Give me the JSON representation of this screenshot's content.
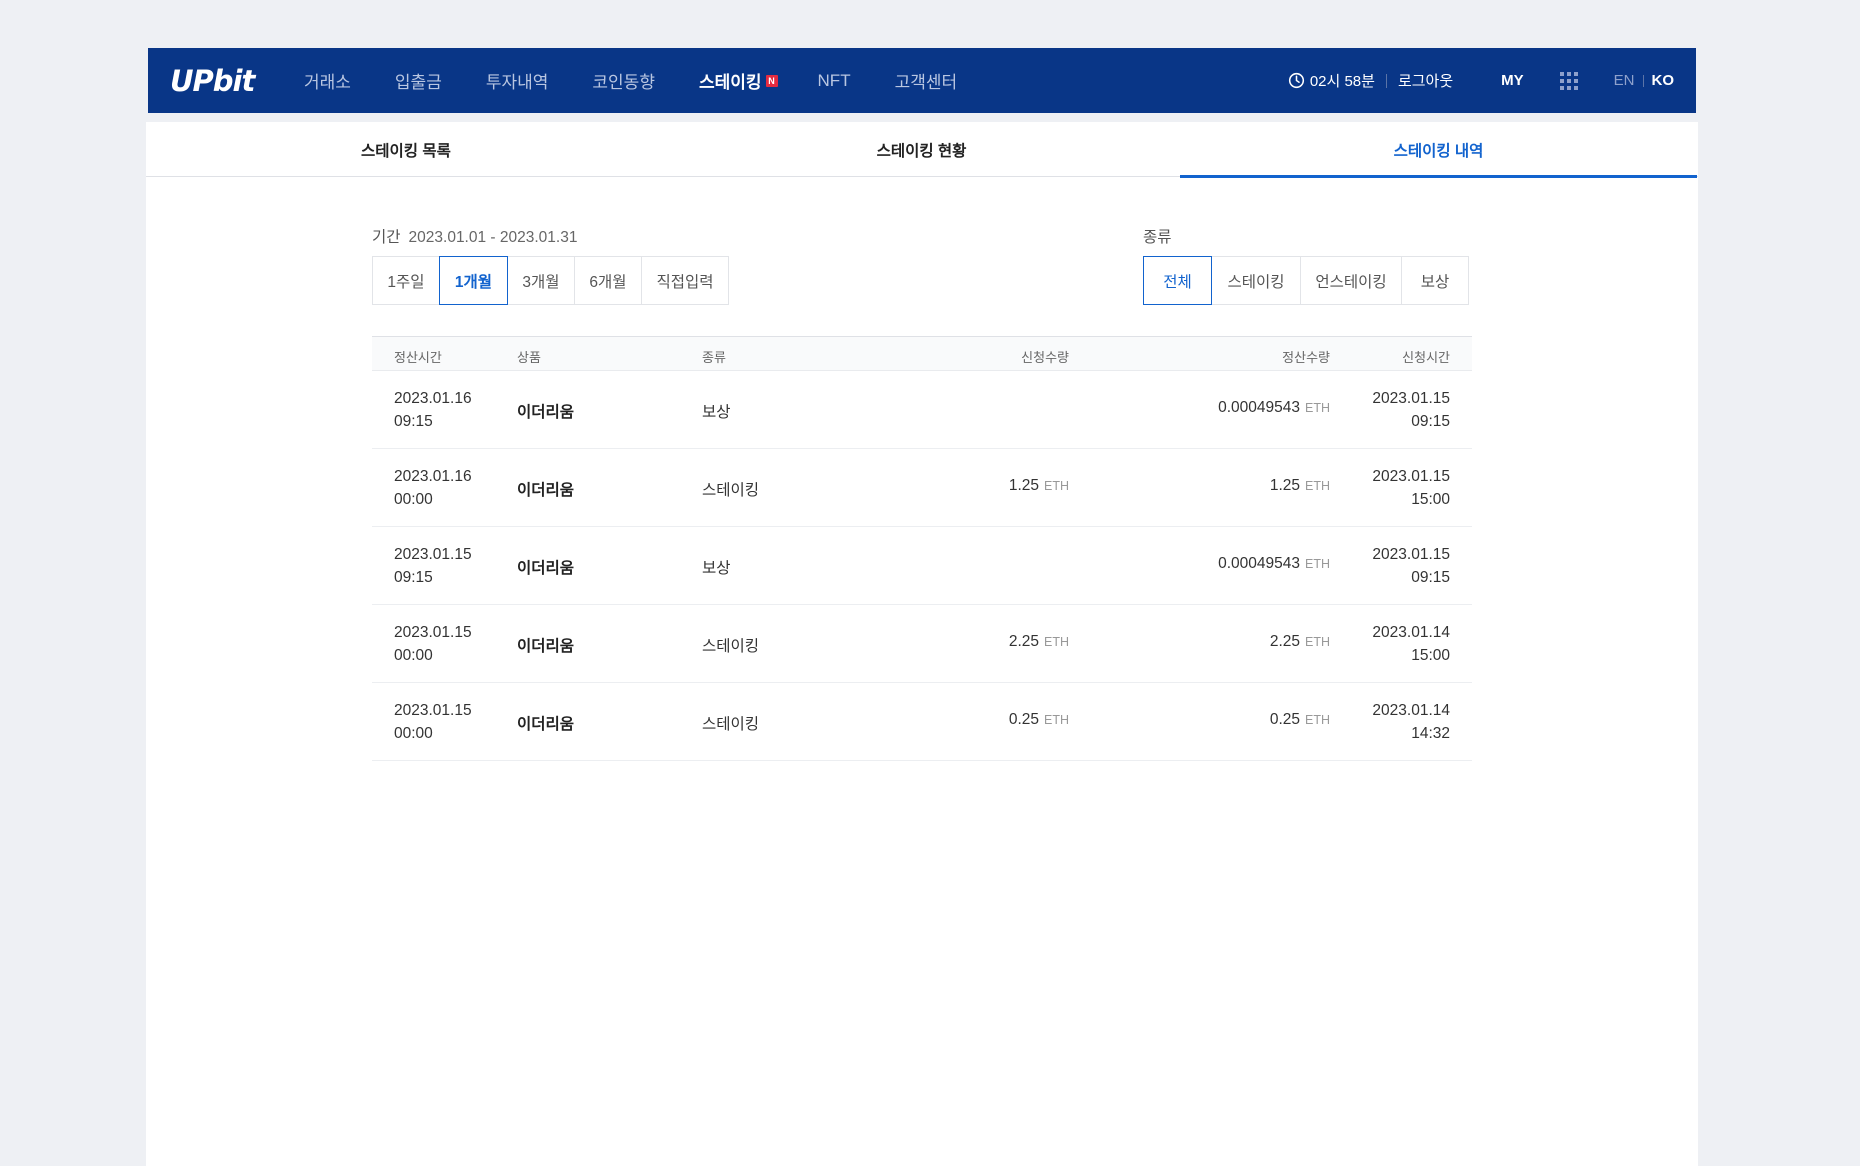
{
  "header": {
    "logo": "UPbit",
    "nav": [
      "거래소",
      "입출금",
      "투자내역",
      "코인동향"
    ],
    "nav_active": "스테이킹",
    "nav_badge": "N",
    "nav_more": [
      "NFT",
      "고객센터"
    ],
    "time": "02시 58분",
    "logout": "로그아웃",
    "my": "MY",
    "lang_en": "EN",
    "lang_ko": "KO"
  },
  "tabs": [
    "스테이킹 목록",
    "스테이킹 현황",
    "스테이킹 내역"
  ],
  "filters": {
    "period_label": "기간",
    "period_range": "2023.01.01 - 2023.01.31",
    "period_options": [
      "1주일",
      "1개월",
      "3개월",
      "6개월",
      "직접입력"
    ],
    "type_label": "종류",
    "type_options": [
      "전체",
      "스테이킹",
      "언스테이킹",
      "보상"
    ]
  },
  "table": {
    "headers": [
      "정산시간",
      "상품",
      "종류",
      "신청수량",
      "정산수량",
      "신청시간"
    ],
    "rows": [
      {
        "settle_date": "2023.01.16",
        "settle_time": "09:15",
        "product": "이더리움",
        "type": "보상",
        "req_amount": "",
        "req_unit": "",
        "settle_amount": "0.00049543",
        "settle_unit": "ETH",
        "apply_date": "2023.01.15",
        "apply_time": "09:15"
      },
      {
        "settle_date": "2023.01.16",
        "settle_time": "00:00",
        "product": "이더리움",
        "type": "스테이킹",
        "req_amount": "1.25",
        "req_unit": "ETH",
        "settle_amount": "1.25",
        "settle_unit": "ETH",
        "apply_date": "2023.01.15",
        "apply_time": "15:00"
      },
      {
        "settle_date": "2023.01.15",
        "settle_time": "09:15",
        "product": "이더리움",
        "type": "보상",
        "req_amount": "",
        "req_unit": "",
        "settle_amount": "0.00049543",
        "settle_unit": "ETH",
        "apply_date": "2023.01.15",
        "apply_time": "09:15"
      },
      {
        "settle_date": "2023.01.15",
        "settle_time": "00:00",
        "product": "이더리움",
        "type": "스테이킹",
        "req_amount": "2.25",
        "req_unit": "ETH",
        "settle_amount": "2.25",
        "settle_unit": "ETH",
        "apply_date": "2023.01.14",
        "apply_time": "15:00"
      },
      {
        "settle_date": "2023.01.15",
        "settle_time": "00:00",
        "product": "이더리움",
        "type": "스테이킹",
        "req_amount": "0.25",
        "req_unit": "ETH",
        "settle_amount": "0.25",
        "settle_unit": "ETH",
        "apply_date": "2023.01.14",
        "apply_time": "14:32"
      }
    ]
  },
  "colors": {
    "header_bg": "#093687",
    "accent": "#1263ce",
    "badge": "#e42b40"
  }
}
